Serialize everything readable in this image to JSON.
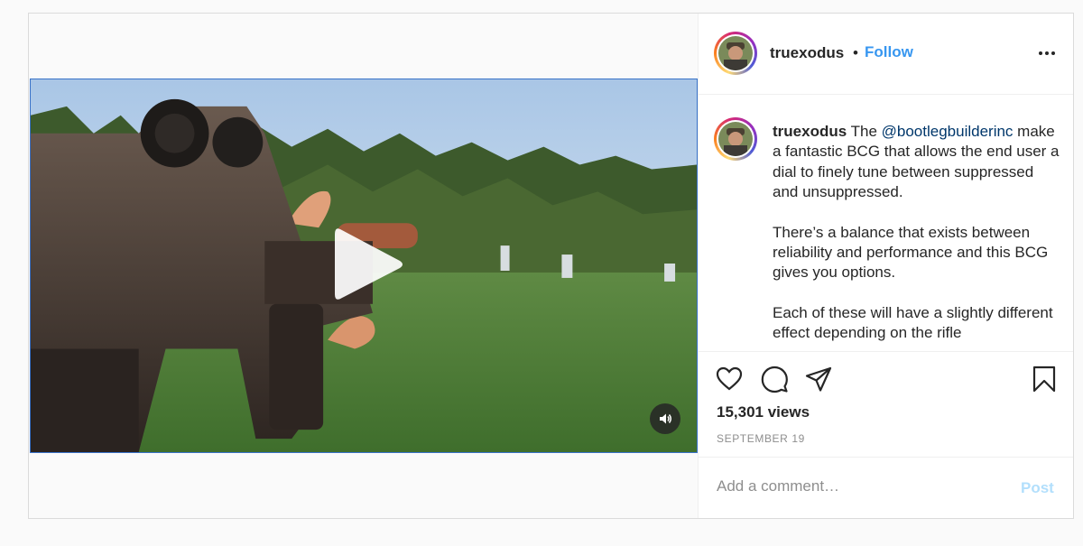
{
  "post": {
    "author": {
      "username": "truexodus",
      "separator": "•",
      "follow_label": "Follow"
    },
    "menu_icon": "more-horizontal-icon",
    "media": {
      "type": "video",
      "play_icon": "play-icon",
      "mute_icon": "speaker-icon"
    },
    "caption": {
      "username": "truexodus",
      "lead": "The ",
      "mention": "@bootlegbuilderinc",
      "p1_rest": " make a fantastic BCG that allows the end user a dial to finely tune between suppressed and unsuppressed.",
      "p2": "There’s a balance that exists between reliability and performance and this BCG gives you options.",
      "p3": "Each of these will have a slightly different effect depending on the rifle"
    },
    "actions": {
      "like_icon": "heart-icon",
      "comment_icon": "comment-icon",
      "share_icon": "paper-plane-icon",
      "save_icon": "bookmark-icon"
    },
    "views": "15,301 views",
    "date": "SEPTEMBER 19",
    "comment": {
      "placeholder": "Add a comment…",
      "post_label": "Post"
    },
    "colors": {
      "link_blue": "#3897f0",
      "mention_blue": "#00376b",
      "post_disabled": "#b2dffc",
      "muted_text": "#8e8e8e"
    }
  }
}
